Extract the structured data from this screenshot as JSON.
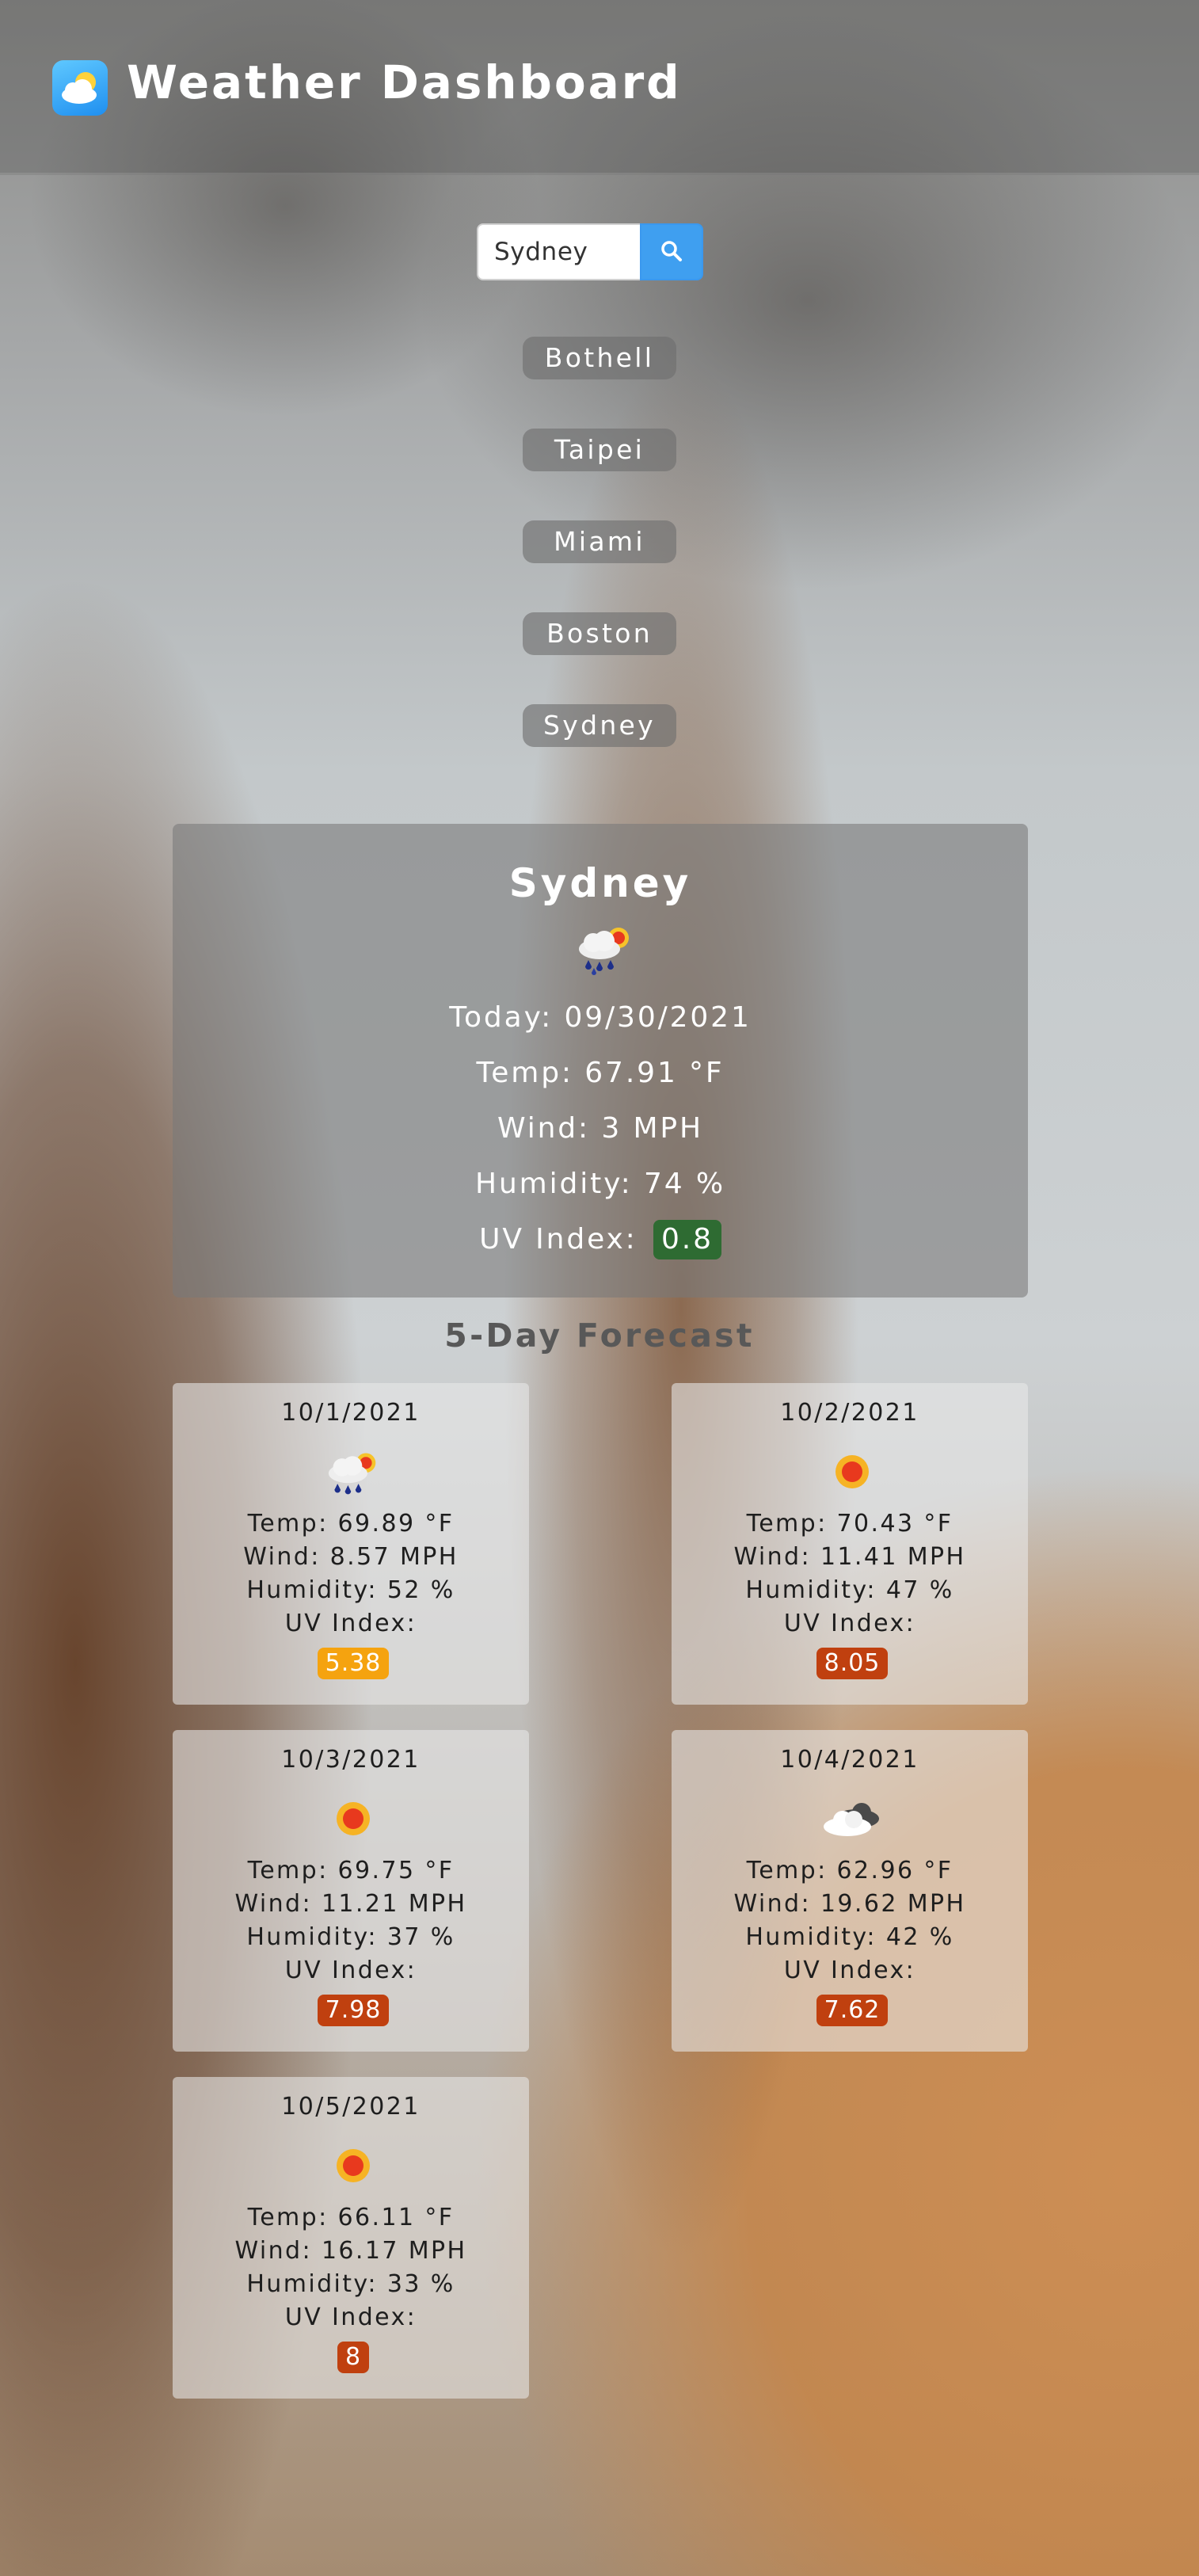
{
  "header": {
    "title": "Weather Dashboard",
    "logo_icon": "cloud-sun-icon"
  },
  "search": {
    "value": "Sydney",
    "button_icon": "search-icon",
    "button_color": "#3f9ff0"
  },
  "history": [
    "Bothell",
    "Taipei",
    "Miami",
    "Boston",
    "Sydney"
  ],
  "current": {
    "city": "Sydney",
    "icon": "rain-sun-icon",
    "date_text": "Today: 09/30/2021",
    "temp_text": "Temp: 67.91 °F",
    "wind_text": "Wind: 3 MPH",
    "humidity_text": "Humidity: 74 %",
    "uv_label": "UV Index:",
    "uv_value": "0.8",
    "uv_color": "#2e6b32"
  },
  "forecast_heading": "5-Day Forecast",
  "forecast": [
    {
      "date": "10/1/2021",
      "icon": "rain-sun-icon",
      "temp": "Temp: 69.89 °F",
      "wind": "Wind: 8.57 MPH",
      "humidity": "Humidity: 52 %",
      "uv_label": "UV Index:",
      "uv_value": "5.38",
      "uv_color": "#f5a30f"
    },
    {
      "date": "10/2/2021",
      "icon": "sun-icon",
      "temp": "Temp: 70.43 °F",
      "wind": "Wind: 11.41 MPH",
      "humidity": "Humidity: 47 %",
      "uv_label": "UV Index:",
      "uv_value": "8.05",
      "uv_color": "#c0400f"
    },
    {
      "date": "10/3/2021",
      "icon": "sun-icon",
      "temp": "Temp: 69.75 °F",
      "wind": "Wind: 11.21 MPH",
      "humidity": "Humidity: 37 %",
      "uv_label": "UV Index:",
      "uv_value": "7.98",
      "uv_color": "#c0400f"
    },
    {
      "date": "10/4/2021",
      "icon": "cloud-icon",
      "temp": "Temp: 62.96 °F",
      "wind": "Wind: 19.62 MPH",
      "humidity": "Humidity: 42 %",
      "uv_label": "UV Index:",
      "uv_value": "7.62",
      "uv_color": "#c0400f"
    },
    {
      "date": "10/5/2021",
      "icon": "sun-icon",
      "temp": "Temp: 66.11 °F",
      "wind": "Wind: 16.17 MPH",
      "humidity": "Humidity: 33 %",
      "uv_label": "UV Index:",
      "uv_value": "8",
      "uv_color": "#c0400f"
    }
  ]
}
